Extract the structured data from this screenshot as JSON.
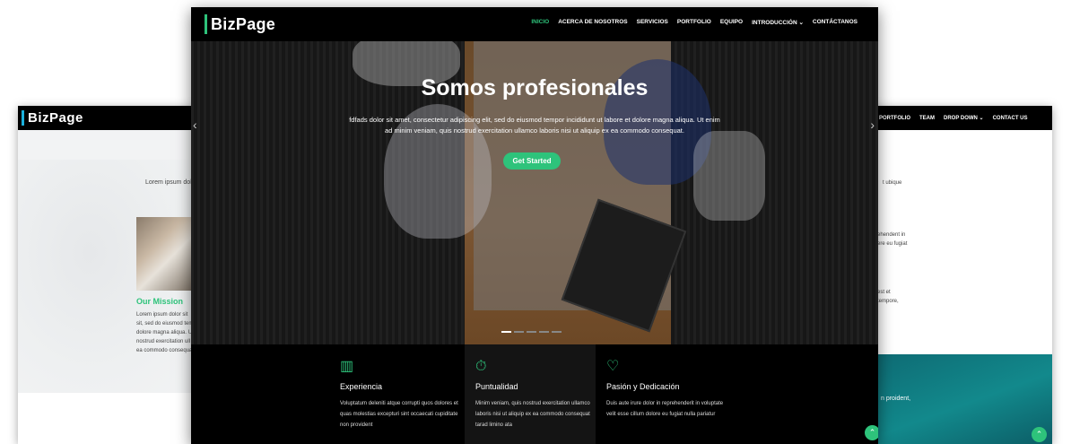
{
  "left_screen": {
    "logo": "BizPage",
    "lorem": "Lorem ipsum dolo",
    "mission_title": "Our Mission",
    "mission_lines": [
      "Lorem ipsum dolor sit",
      "sit, sed do eiusmod tem",
      "dolore magna aliqua. U",
      "nostrud exercitation ull",
      "ea commodo consequat."
    ]
  },
  "right_screen": {
    "menu": [
      "PORTFOLIO",
      "TEAM",
      "DROP DOWN ⌄",
      "CONTACT US"
    ],
    "lines": [
      "t ubique",
      "ehendent in",
      "ere eu fugiat",
      "est et",
      "tempore,"
    ],
    "teal_text": "n proident,",
    "up_icon": "⌃"
  },
  "main": {
    "logo": "BizPage",
    "menu": [
      "INICIO",
      "ACERCA DE NOSOTROS",
      "SERVICIOS",
      "PORTFOLIO",
      "EQUIPO",
      "INTRODUCCIÓN ⌄",
      "CONTÁCTANOS"
    ],
    "hero": {
      "title": "Somos profesionales",
      "text": "fdfads dolor sit amet, consectetur adipiscing elit, sed do eiusmod tempor incididunt ut labore et dolore magna aliqua. Ut enim ad minim veniam, quis nostrud exercitation ullamco laboris nisi ut aliquip ex ea commodo consequat.",
      "cta": "Get Started",
      "prev": "‹",
      "next": "›"
    },
    "features": [
      {
        "icon": "▥",
        "title": "Experiencia",
        "text": "Voluptatum deleniti atque corrupti quos dolores et quas molestias excepturi sint occaecati cupiditate non provident"
      },
      {
        "icon": "⏱",
        "title": "Puntualidad",
        "text": "Minim veniam, quis nostrud exercitation ullamco laboris nisi ut aliquip ex ea commodo consequat tarad limino ata"
      },
      {
        "icon": "♡",
        "title": "Pasión y Dedicación",
        "text": "Duis aute irure dolor in reprehenderit in voluptate velit esse cillum dolore eu fugiat nulla pariatur"
      }
    ],
    "up_icon": "⌃"
  },
  "colors": {
    "accent": "#2ec37b",
    "nav": "#000000",
    "teal": "#12898c"
  }
}
